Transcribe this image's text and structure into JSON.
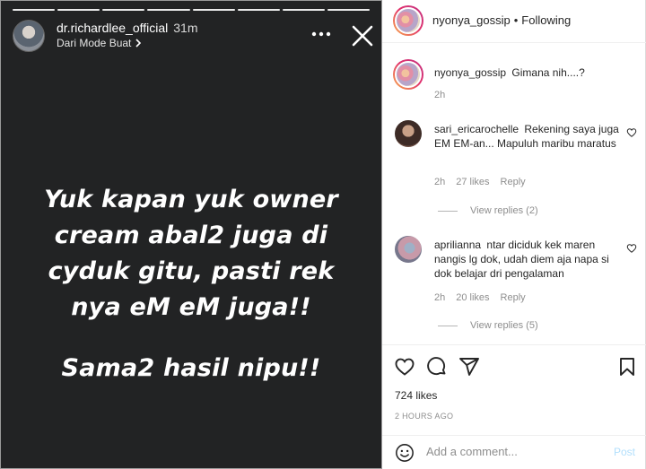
{
  "story": {
    "username": "dr.richardlee_official",
    "time": "31m",
    "subtitle": "Dari Mode Buat",
    "segments": 8,
    "text_lines": [
      "Yuk kapan yuk owner",
      "cream abal2 juga di",
      "cyduk gitu, pasti rek",
      "nya eM eM juga!!"
    ],
    "text_last": "Sama2 hasil nipu!!"
  },
  "post": {
    "header": {
      "username": "nyonya_gossip",
      "separator": "•",
      "follow_label": "Following"
    },
    "caption": {
      "username": "nyonya_gossip",
      "text": "Gimana nih....?",
      "time": "2h"
    },
    "comments": [
      {
        "username": "sari_ericarochelle",
        "text": "Rekening saya juga EM EM-an... Mapuluh maribu maratus",
        "time": "2h",
        "likes": "27 likes",
        "reply_label": "Reply",
        "view_replies": "View replies (2)"
      },
      {
        "username": "aprilianna",
        "text": "ntar diciduk kek maren nangis lg dok, udah diem aja napa si dok belajar dri pengalaman",
        "time": "2h",
        "likes": "20 likes",
        "reply_label": "Reply",
        "view_replies": "View replies (5)"
      }
    ],
    "likes": "724 likes",
    "timestamp": "2 HOURS AGO",
    "comment_placeholder": "Add a comment...",
    "post_label": "Post",
    "icons": [
      "heart-icon",
      "comment-icon",
      "share-icon",
      "bookmark-icon",
      "emoji-icon"
    ]
  },
  "colors": {
    "story_bg": "#222324",
    "link_blue": "#b2dffc",
    "muted": "#8e8e8e"
  }
}
